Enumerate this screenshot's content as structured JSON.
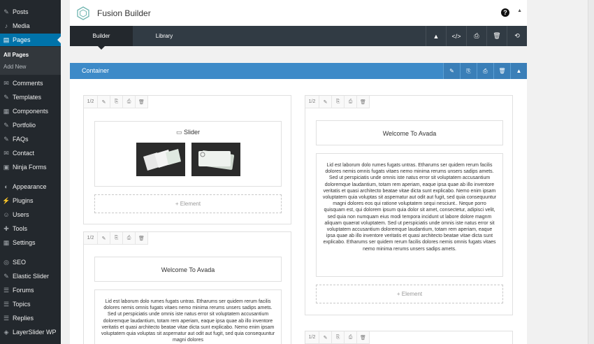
{
  "sidebar": {
    "items": [
      {
        "label": "Posts",
        "icon": "pin-icon"
      },
      {
        "label": "Media",
        "icon": "media-icon"
      },
      {
        "label": "Pages",
        "icon": "pages-icon",
        "active": true
      },
      {
        "label": "Comments",
        "icon": "comment-icon"
      },
      {
        "label": "Templates",
        "icon": "pin-icon"
      },
      {
        "label": "Components",
        "icon": "components-icon"
      },
      {
        "label": "Portfolio",
        "icon": "pin-icon"
      },
      {
        "label": "FAQs",
        "icon": "pin-icon"
      },
      {
        "label": "Contact",
        "icon": "mail-icon"
      },
      {
        "label": "Ninja Forms",
        "icon": "forms-icon"
      },
      {
        "label": "Appearance",
        "icon": "paint-icon"
      },
      {
        "label": "Plugins",
        "icon": "plug-icon"
      },
      {
        "label": "Users",
        "icon": "users-icon"
      },
      {
        "label": "Tools",
        "icon": "wrench-icon"
      },
      {
        "label": "Settings",
        "icon": "settings-icon"
      },
      {
        "label": "SEO",
        "icon": "seo-icon"
      },
      {
        "label": "Elastic Slider",
        "icon": "pin-icon"
      },
      {
        "label": "Forums",
        "icon": "forums-icon"
      },
      {
        "label": "Topics",
        "icon": "topics-icon"
      },
      {
        "label": "Replies",
        "icon": "replies-icon"
      },
      {
        "label": "LayerSlider WP",
        "icon": "layers-icon"
      }
    ],
    "submenu": [
      "All Pages",
      "Add New"
    ]
  },
  "header": {
    "title": "Fusion Builder",
    "help": "?",
    "collapse": "▲"
  },
  "tabs": {
    "builder": "Builder",
    "library": "Library"
  },
  "toolbar_icons": [
    "▲",
    "</>",
    "⎙",
    "🗑",
    "⟲"
  ],
  "container": {
    "label": "Container",
    "icons": [
      "✎",
      "⎘",
      "⎙",
      "🗑",
      "▲"
    ]
  },
  "column_size": "1/2",
  "column_tools": [
    "✎",
    "⎘",
    "⎙",
    "🗑"
  ],
  "left_column": {
    "slider_title": "Slider",
    "add_element": "+ Element"
  },
  "left_column_2": {
    "title": "Welcome To Avada",
    "text": "Lid est laborum dolo rumes fugats untras. Etharums ser quidem rerum facilis dolores nemis omnis fugats vitaes nemo minima rerums unsers sadips amets. Sed ut perspiciatis unde omnis iste natus error sit voluptatem accusantium doloremque laudantium, totam rem aperiam, eaque ipsa quae ab illo inventore veritatis et quasi architecto beatae vitae dicta sunt explicabo. Nemo enim ipsam voluptatem quia voluptas sit aspernatur aut odit aut fugit, sed quia consequuntur magni dolores"
  },
  "right_column": {
    "title": "Welcome To Avada",
    "text": "Lid est laborum dolo rumes fugats untras. Etharums ser quidem rerum facilis dolores nemis omnis fugats vitaes nemo minima rerums unsers sadips amets. Sed ut perspiciatis unde omnis iste natus error sit voluptatem accusantium doloremque laudantium, totam rem aperiam, eaque ipsa quae ab illo inventore veritatis et quasi architecto beatae vitae dicta sunt explicabo. Nemo enim ipsam voluptatem quia voluptas sit aspernatur aut odit aut fugit, sed quia consequuntur magni dolores eos qui ratione voluptatem sequi nesciunt.. Neque porro quisquam est, qui dolorem ipsum quia dolor sit amet, consectetur, adipisci velit, sed quia non numquam eius modi tempora incidunt ut labore dolore magnm aliquam quaerat voluptatem. Sed ut perspiciatis unde omnis iste natus error sit voluptatem accusantium doloremque laudantium, totam rem aperiam, eaque ipsa quae ab illo inventore veritatis et quasi architecto beatae vitae dicta sunt explicabo. Etharums ser quidem rerum facilis dolores nemis omnis fugats vitaes nemo minima rerums unsers sadips amets.",
    "add_element": "+ Element"
  }
}
